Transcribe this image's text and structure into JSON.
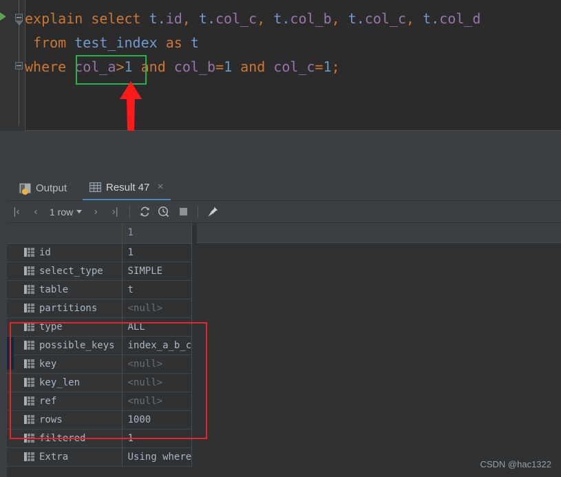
{
  "editor": {
    "run_arrow_title": "run",
    "lines": [
      {
        "id": "line1",
        "tokens": [
          {
            "t": "explain",
            "c": "kw"
          },
          {
            "t": " ",
            "c": "plain"
          },
          {
            "t": "select",
            "c": "kw"
          },
          {
            "t": " ",
            "c": "plain"
          },
          {
            "t": "t",
            "c": "alias"
          },
          {
            "t": ".",
            "c": "alias"
          },
          {
            "t": "id",
            "c": "col"
          },
          {
            "t": ", ",
            "c": "punc"
          },
          {
            "t": "t",
            "c": "alias"
          },
          {
            "t": ".",
            "c": "alias"
          },
          {
            "t": "col_c",
            "c": "col"
          },
          {
            "t": ", ",
            "c": "punc"
          },
          {
            "t": "t",
            "c": "alias"
          },
          {
            "t": ".",
            "c": "alias"
          },
          {
            "t": "col_b",
            "c": "col"
          },
          {
            "t": ", ",
            "c": "punc"
          },
          {
            "t": "t",
            "c": "alias"
          },
          {
            "t": ".",
            "c": "alias"
          },
          {
            "t": "col_c",
            "c": "col"
          },
          {
            "t": ", ",
            "c": "punc"
          },
          {
            "t": "t",
            "c": "alias"
          },
          {
            "t": ".",
            "c": "alias"
          },
          {
            "t": "col_d",
            "c": "col"
          }
        ]
      },
      {
        "id": "line2",
        "tokens": [
          {
            "t": " ",
            "c": "plain"
          },
          {
            "t": "from",
            "c": "kw"
          },
          {
            "t": " ",
            "c": "plain"
          },
          {
            "t": "test_index",
            "c": "alias"
          },
          {
            "t": " ",
            "c": "plain"
          },
          {
            "t": "as",
            "c": "kw"
          },
          {
            "t": " ",
            "c": "plain"
          },
          {
            "t": "t",
            "c": "alias"
          }
        ]
      },
      {
        "id": "line3",
        "tokens": [
          {
            "t": "where",
            "c": "kw"
          },
          {
            "t": " ",
            "c": "plain"
          },
          {
            "t": "col_a",
            "c": "col"
          },
          {
            "t": ">",
            "c": "punc"
          },
          {
            "t": "1",
            "c": "num"
          },
          {
            "t": " ",
            "c": "plain"
          },
          {
            "t": "and",
            "c": "kw"
          },
          {
            "t": " ",
            "c": "plain"
          },
          {
            "t": "col_b",
            "c": "col"
          },
          {
            "t": "=",
            "c": "punc"
          },
          {
            "t": "1",
            "c": "num"
          },
          {
            "t": " ",
            "c": "plain"
          },
          {
            "t": "and",
            "c": "kw"
          },
          {
            "t": " ",
            "c": "plain"
          },
          {
            "t": "col_c",
            "c": "col"
          },
          {
            "t": "=",
            "c": "punc"
          },
          {
            "t": "1",
            "c": "num"
          },
          {
            "t": ";",
            "c": "punc"
          }
        ]
      }
    ],
    "full_sql": "explain select t.id, t.col_c, t.col_b, t.col_c, t.col_d from test_index as t where col_a>1 and col_b=1 and col_c=1;"
  },
  "annotations": {
    "green_box_target": "col_a>1",
    "green_box_color": "#29b14a",
    "red_arrow_color": "#ff1a1a",
    "red_box_color": "#e8262a",
    "red_box_rows": [
      "type",
      "possible_keys",
      "key",
      "key_len",
      "ref",
      "rows"
    ]
  },
  "panel": {
    "tabs": [
      {
        "id": "output",
        "label": "Output",
        "icon": "console-icon",
        "active": false,
        "closable": false
      },
      {
        "id": "result",
        "label": "Result 47",
        "icon": "grid-icon",
        "active": true,
        "closable": true,
        "close_label": "×"
      }
    ],
    "toolbar": {
      "first_page": "|‹",
      "prev_page": "‹",
      "row_count": "1 row",
      "next_page": "›",
      "last_page": "›|",
      "refresh": "refresh-icon",
      "history": "history-icon",
      "stop": "stop-icon",
      "pin": "pin-icon"
    }
  },
  "grid": {
    "header": {
      "name_col": "",
      "value_col": "1"
    },
    "rows": [
      {
        "name": "id",
        "value": "1",
        "null": false,
        "boxed": false
      },
      {
        "name": "select_type",
        "value": "SIMPLE",
        "null": false,
        "boxed": false
      },
      {
        "name": "table",
        "value": "t",
        "null": false,
        "boxed": false
      },
      {
        "name": "partitions",
        "value": "<null>",
        "null": true,
        "boxed": false
      },
      {
        "name": "type",
        "value": "ALL",
        "null": false,
        "boxed": true
      },
      {
        "name": "possible_keys",
        "value": "index_a_b_c",
        "null": false,
        "boxed": true
      },
      {
        "name": "key",
        "value": "<null>",
        "null": true,
        "boxed": true
      },
      {
        "name": "key_len",
        "value": "<null>",
        "null": true,
        "boxed": true
      },
      {
        "name": "ref",
        "value": "<null>",
        "null": true,
        "boxed": true
      },
      {
        "name": "rows",
        "value": "1000",
        "null": false,
        "boxed": true
      },
      {
        "name": "filtered",
        "value": "1",
        "null": false,
        "boxed": false
      },
      {
        "name": "Extra",
        "value": "Using where",
        "null": false,
        "boxed": false
      }
    ]
  },
  "watermark": "CSDN @hac1322"
}
